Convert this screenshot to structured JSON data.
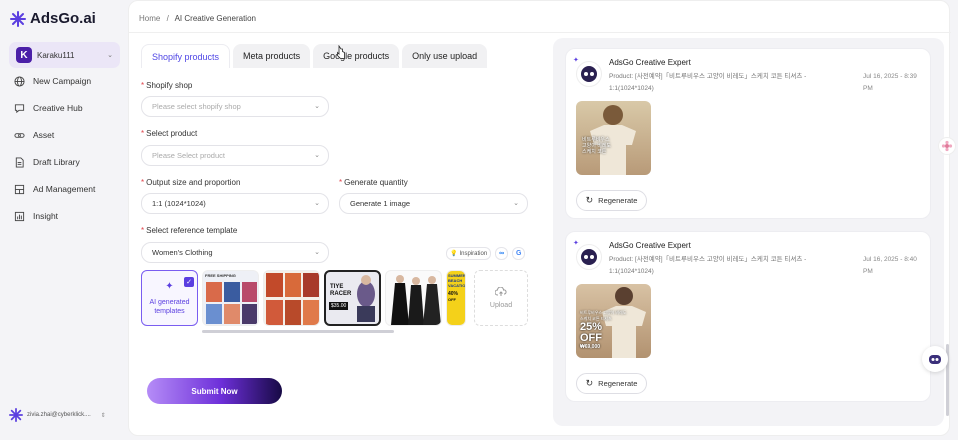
{
  "app": {
    "logo_text": "AdsGo.ai",
    "brand_color": "#5b3fe0"
  },
  "workspace": {
    "initial": "K",
    "name": "Karaku111"
  },
  "sidebar": {
    "items": [
      {
        "label": "New Campaign",
        "icon": "globe-icon"
      },
      {
        "label": "Creative Hub",
        "icon": "chat-icon"
      },
      {
        "label": "Asset",
        "icon": "link-icon"
      },
      {
        "label": "Draft Library",
        "icon": "document-icon"
      },
      {
        "label": "Ad Management",
        "icon": "grid-icon"
      },
      {
        "label": "Insight",
        "icon": "bar-chart-icon"
      }
    ]
  },
  "user": {
    "email": "zivia.zhai@cyberklick...."
  },
  "breadcrumb": {
    "home": "Home",
    "separator": "/",
    "current": "AI Creative Generation"
  },
  "tabs": [
    {
      "label": "Shopify products",
      "active": true
    },
    {
      "label": "Meta products",
      "active": false
    },
    {
      "label": "Google products",
      "active": false
    },
    {
      "label": "Only use upload",
      "active": false
    }
  ],
  "form": {
    "shop_label": "Shopify shop",
    "shop_placeholder": "Please select shopify shop",
    "product_label": "Select product",
    "product_placeholder": "Please Select product",
    "size_label": "Output size and proportion",
    "size_value": "1:1 (1024*1024)",
    "quantity_label": "Generate quantity",
    "quantity_value": "Generate 1 image",
    "template_label": "Select reference template",
    "template_value": "Women's Clothing",
    "inspiration_label": "Inspiration",
    "ai_template_label": "AI generated templates",
    "upload_label": "Upload",
    "submit_label": "Submit Now"
  },
  "templates": [
    {
      "kind": "dresses-grid",
      "banner_text": "FREE SHIPPING"
    },
    {
      "kind": "orange-dresses"
    },
    {
      "kind": "tiye-racer",
      "line1": "TIYE",
      "line2": "RACER",
      "price": "$35.00"
    },
    {
      "kind": "black-dresses"
    },
    {
      "kind": "yellow-promo",
      "lines": [
        "SUMMER",
        "BEACH",
        "VACATION"
      ],
      "off": "40%",
      "off2": "OFF"
    }
  ],
  "results": [
    {
      "title": "AdsGo Creative Expert",
      "product": "Product: [사전예약]「비트루비우스 고양이 비레도」스케치 코튼 티셔츠 - 1:1(1024*1024)",
      "time": "Jul 16, 2025 - 8:39 PM",
      "image_text": [
        "비트루비우스",
        "고양이 비레도",
        "스케치 코튼"
      ],
      "regenerate_label": "Regenerate"
    },
    {
      "title": "AdsGo Creative Expert",
      "product": "Product: [사전예약]「비트루비우스 고양이 비레도」스케치 코튼 티셔츠 - 1:1(1024*1024)",
      "time": "Jul 16, 2025 - 8:40 PM",
      "image_text": [
        "비트루비우스 고양이 비레도",
        "스케치 코튼 티셔츠"
      ],
      "image_big": "25%",
      "image_big2": "OFF",
      "image_price": "₩69,000",
      "regenerate_label": "Regenerate"
    }
  ]
}
